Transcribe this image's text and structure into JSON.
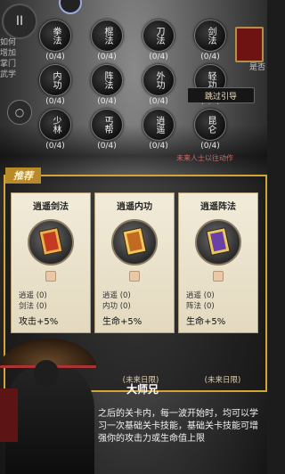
{
  "top": {
    "menu_icon": "pause-icon",
    "menu_glyph": "II",
    "left_text": "如何\n增加\n掌门\n武学",
    "left_circle_glyph": "○",
    "right_text": "是否"
  },
  "skills": [
    {
      "name": "拳法",
      "count": "(0/4)"
    },
    {
      "name": "棍法",
      "count": "(0/4)"
    },
    {
      "name": "刀法",
      "count": "(0/4)"
    },
    {
      "name": "剑法",
      "count": "(0/4)"
    },
    {
      "name": "内功",
      "count": "(0/4)"
    },
    {
      "name": "阵法",
      "count": "(0/4)"
    },
    {
      "name": "外功",
      "count": "(0/4)"
    },
    {
      "name": "轻功",
      "count": "(0/4)"
    },
    {
      "name": "少林",
      "count": "(0/4)"
    },
    {
      "name": "丐帮",
      "count": "(0/4)"
    },
    {
      "name": "逍遥",
      "count": "(0/4)"
    },
    {
      "name": "昆仑",
      "count": "(0/4)"
    }
  ],
  "skip_button": "跳过引导",
  "notice": "未来人士以往动作",
  "panel_tag": "推荐",
  "cards": [
    {
      "title": "逍遥剑法",
      "line1": "逍遥 (0)",
      "line2": "剑法 (0)",
      "bonus": "攻击+5%",
      "book_color": "#c23a22",
      "book_trim": "#e8b04a"
    },
    {
      "title": "逍遥内功",
      "line1": "逍遥 (0)",
      "line2": "内功 (0)",
      "bonus": "生命+5%",
      "book_color": "#c26a22",
      "book_trim": "#f0c860"
    },
    {
      "title": "逍遥阵法",
      "line1": "逍遥 (0)",
      "line2": "阵法 (0)",
      "bonus": "生命+5%",
      "book_color": "#6a3fa8",
      "book_trim": "#e8c860"
    }
  ],
  "footer_labels": [
    "(未来日限)",
    "(未来日限)"
  ],
  "dialog": {
    "name": "大师兄",
    "text": "之后的关卡内，每一波开始时，均可以学习一次基础关卡技能，基础关卡技能可增强你的攻击力或生命值上限"
  },
  "colors": {
    "panel_border": "#d2a634",
    "accent_red": "#c23a22",
    "card_bg": "#f1ebd9"
  }
}
